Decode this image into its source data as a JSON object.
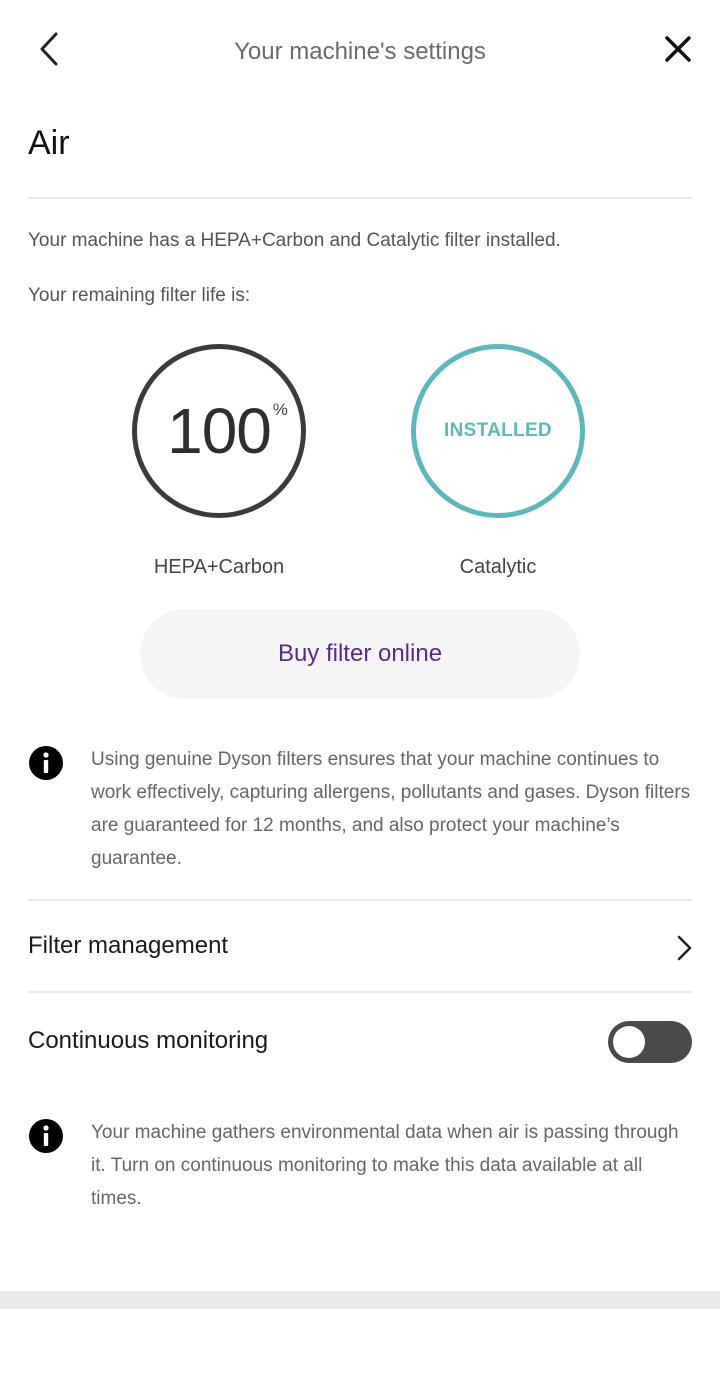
{
  "header": {
    "title": "Your machine's settings",
    "back_icon": "chevron-left-icon",
    "close_icon": "close-icon"
  },
  "section": {
    "title": "Air"
  },
  "filter_info": {
    "installed_text": "Your machine has a HEPA+Carbon and Catalytic filter installed.",
    "remaining_label": "Your remaining filter life is:"
  },
  "filters": [
    {
      "name": "HEPA+Carbon",
      "value": "100",
      "unit": "%",
      "life_fraction": 1.0,
      "color": "#3b3b3b"
    },
    {
      "name": "Catalytic",
      "status": "INSTALLED",
      "color": "#5bb8bb"
    }
  ],
  "buy_button": {
    "label": "Buy filter online",
    "color": "#5a2b83"
  },
  "genuine_info": {
    "icon": "info-icon",
    "text": "Using genuine Dyson filters ensures that your machine continues to work effectively, capturing allergens, pollutants and gases. Dyson filters are guaranteed for 12 months, and also protect your machine’s guarantee."
  },
  "filter_management": {
    "label": "Filter management",
    "icon": "chevron-right-icon"
  },
  "continuous_monitoring": {
    "label": "Continuous monitoring",
    "enabled": false,
    "info_text": "Your machine gathers environmental data when air is passing through it. Turn on continuous monitoring to make this data available at all times."
  }
}
